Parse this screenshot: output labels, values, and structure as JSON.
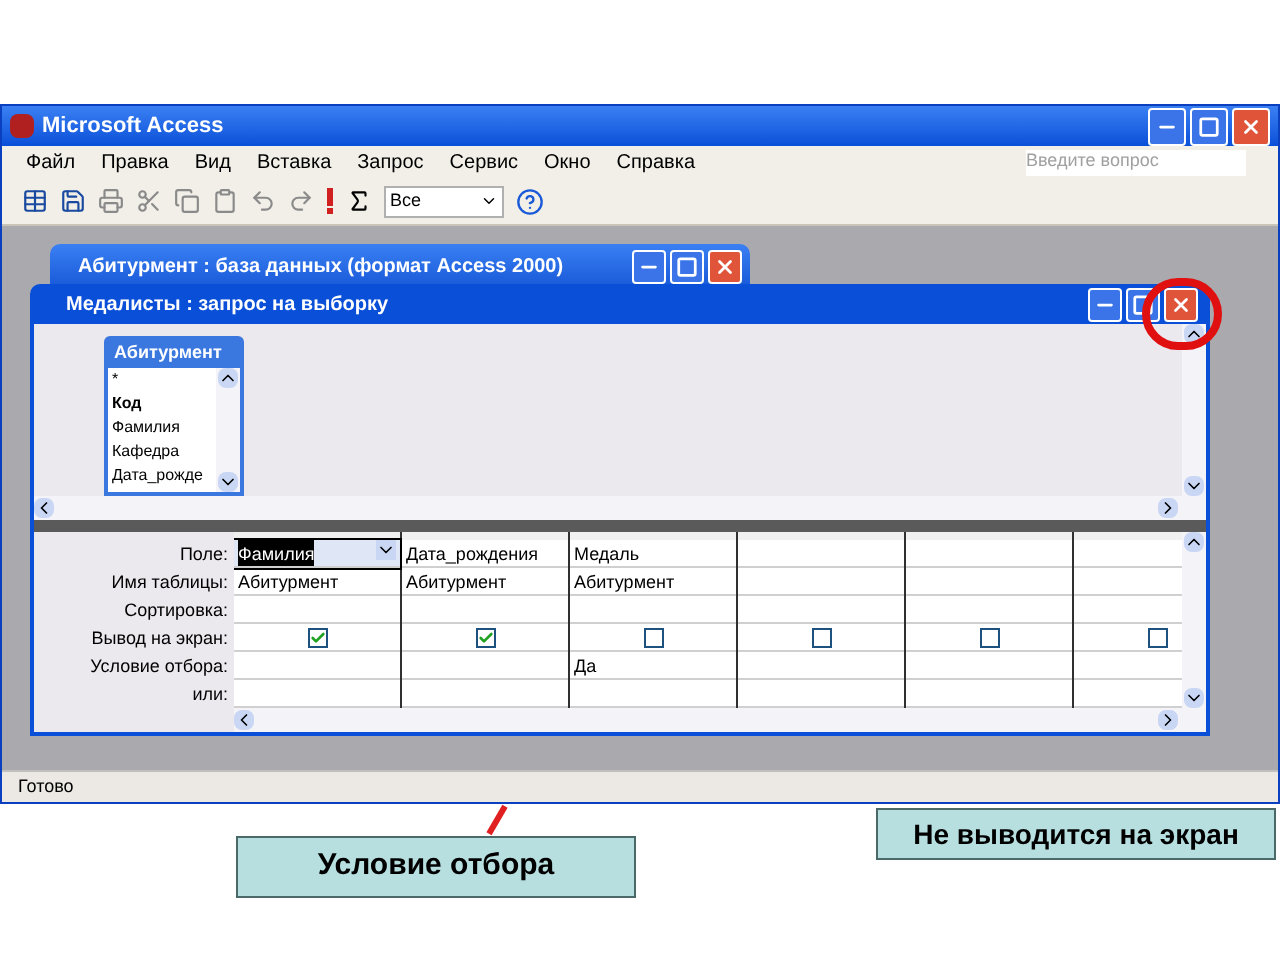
{
  "window": {
    "title": "Microsoft Access"
  },
  "menu": [
    "Файл",
    "Правка",
    "Вид",
    "Вставка",
    "Запрос",
    "Сервис",
    "Окно",
    "Справка"
  ],
  "help_field": {
    "placeholder": "Введите вопрос"
  },
  "toolbar": {
    "query_type": "Все"
  },
  "db_window": {
    "title": "Абитурмент : база данных (формат Access 2000)"
  },
  "query_window": {
    "title": "Медалисты : запрос на выборку",
    "table_box": {
      "title": "Абитурмент",
      "fields": [
        {
          "name": "*",
          "key": false
        },
        {
          "name": "Код",
          "key": true
        },
        {
          "name": "Фамилия",
          "key": false
        },
        {
          "name": "Кафедра",
          "key": false
        },
        {
          "name": "Дата_рожде",
          "key": false
        }
      ]
    },
    "row_labels": [
      "Поле:",
      "Имя таблицы:",
      "Сортировка:",
      "Вывод на экран:",
      "Условие отбора:",
      "или:"
    ],
    "columns": [
      {
        "field": "Фамилия",
        "table": "Абитурмент",
        "show": true,
        "selected": true
      },
      {
        "field": "Дата_рождения",
        "table": "Абитурмент",
        "show": true,
        "selected": false
      },
      {
        "field": "Медаль",
        "table": "Абитурмент",
        "show": false,
        "criteria": "Да",
        "selected": false
      },
      {
        "show": false,
        "selected": false
      },
      {
        "show": false,
        "selected": false
      },
      {
        "show": false,
        "selected": false
      }
    ]
  },
  "status_bar": "Готово",
  "callouts": [
    {
      "text": "Не выводится на экран"
    },
    {
      "text": "Условие отбора"
    }
  ]
}
